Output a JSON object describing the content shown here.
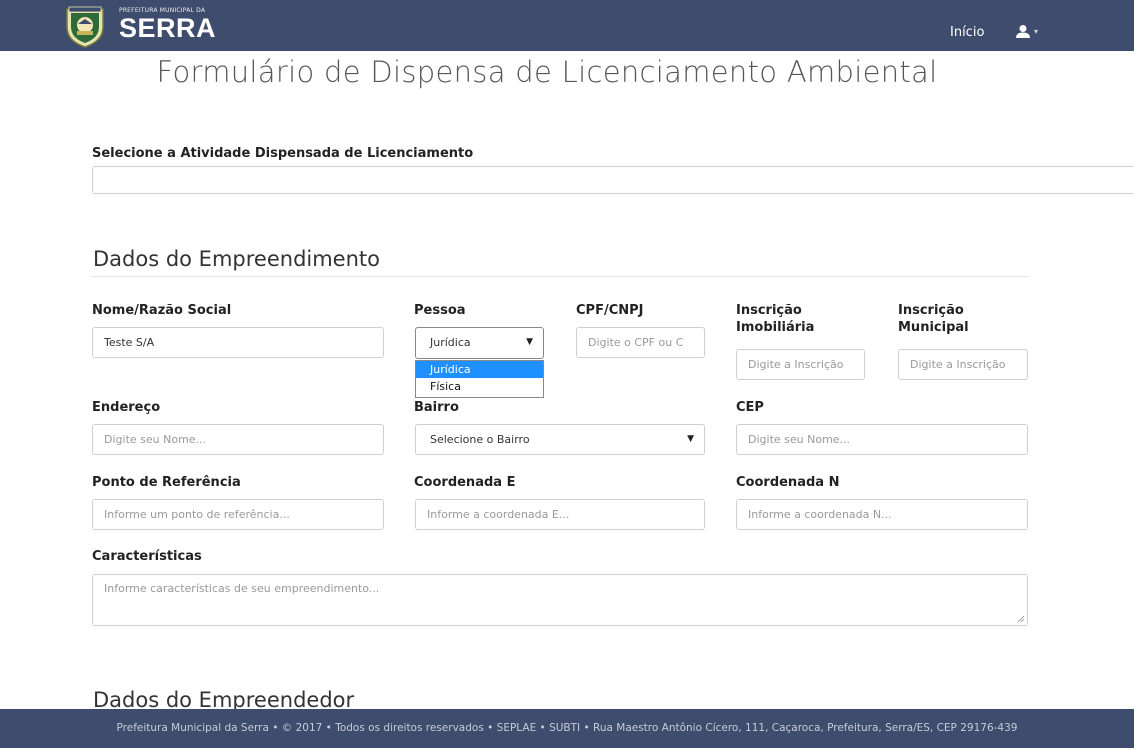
{
  "header": {
    "logo_small": "PREFEITURA MUNICIPAL DA",
    "logo_big": "SERRA",
    "nav_home": "Início",
    "user_icon": "user-icon",
    "caret_icon": "caret-down-icon",
    "color": "#3e4c6d"
  },
  "page": {
    "title": "Formulário de Dispensa de Licenciamento Ambiental"
  },
  "activity": {
    "label": "Selecione a Atividade Dispensada de Licenciamento",
    "value": ""
  },
  "empreendimento": {
    "section_title": "Dados do Empreendimento",
    "nome": {
      "label": "Nome/Razão Social",
      "value": "Teste S/A"
    },
    "pessoa": {
      "label": "Pessoa",
      "value": "Jurídica",
      "options": [
        "Jurídica",
        "Física"
      ],
      "selected_index": 0
    },
    "cpf": {
      "label": "CPF/CNPJ",
      "placeholder": "Digite o CPF ou C"
    },
    "inscricao_imobiliaria": {
      "label_1": "Inscrição",
      "label_2": "Imobiliária",
      "placeholder": "Digite a Inscrição"
    },
    "inscricao_municipal": {
      "label_1": "Inscrição",
      "label_2": "Municipal",
      "placeholder": "Digite a Inscrição"
    },
    "endereco": {
      "label": "Endereço",
      "placeholder": "Digite seu Nome..."
    },
    "bairro": {
      "label": "Bairro",
      "value": "Selecione o Bairro"
    },
    "cep": {
      "label": "CEP",
      "placeholder": "Digite seu Nome..."
    },
    "ponto_referencia": {
      "label": "Ponto de Referência",
      "placeholder": "Informe um ponto de referência..."
    },
    "coord_e": {
      "label": "Coordenada E",
      "placeholder": "Informe a coordenada E..."
    },
    "coord_n": {
      "label": "Coordenada N",
      "placeholder": "Informe a coordenada N..."
    },
    "caracteristicas": {
      "label": "Características",
      "placeholder": "Informe características de seu empreendimento..."
    }
  },
  "empreendedor": {
    "section_title": "Dados do Empreendedor"
  },
  "footer": {
    "text": "Prefeitura Municipal da Serra • © 2017 • Todos os direitos reservados • SEPLAE • SUBTI • Rua Maestro Antônio Cícero, 111, Caçaroca, Prefeitura, Serra/ES, CEP 29176-439"
  }
}
